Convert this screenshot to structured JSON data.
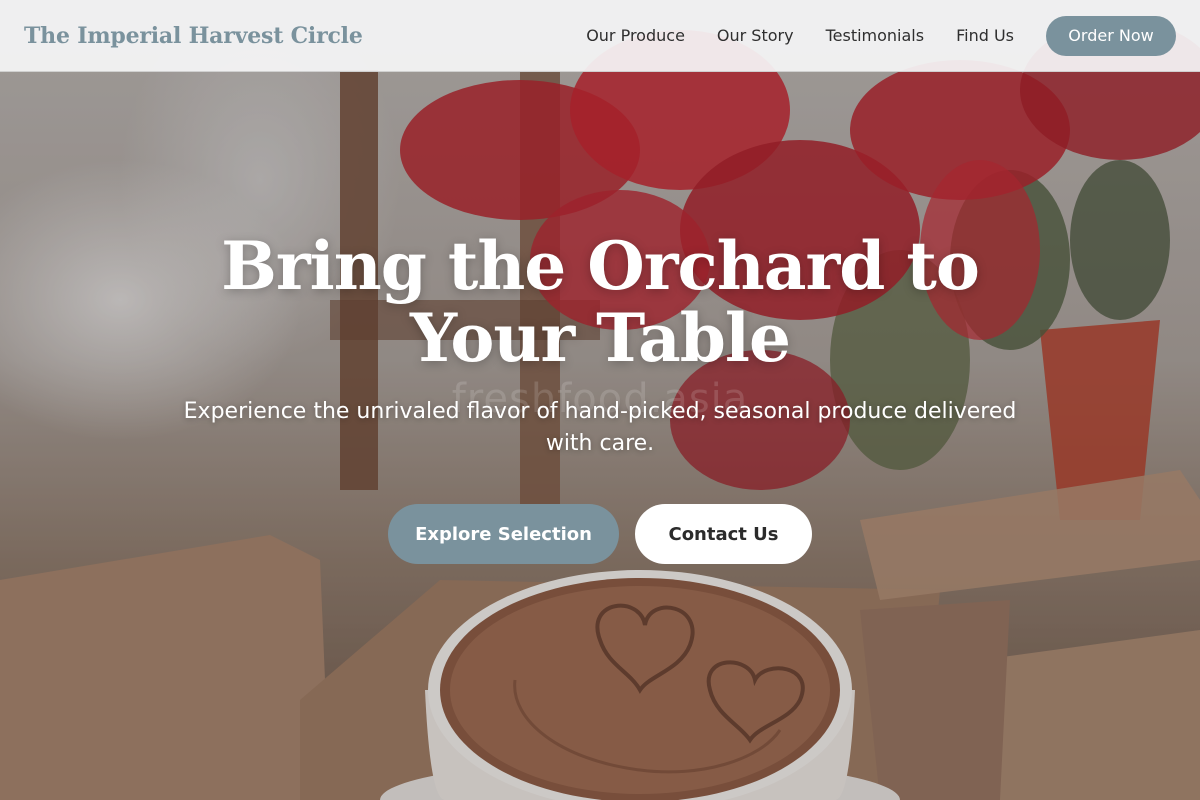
{
  "brand": {
    "name": "The Imperial Harvest Circle"
  },
  "nav": {
    "links": [
      "Our Produce",
      "Our Story",
      "Testimonials",
      "Find Us"
    ],
    "order_label": "Order Now"
  },
  "hero": {
    "title": "Bring the Orchard to Your Table",
    "subtitle": "Experience the unrivaled flavor of hand-picked, seasonal produce delivered with care.",
    "watermark": "freshfood.asia",
    "primary_cta": "Explore Selection",
    "secondary_cta": "Contact Us"
  },
  "colors": {
    "accent": "#7a929d",
    "nav_bg": "#f5f5f6",
    "text_dark": "#2f2f2f",
    "white": "#ffffff"
  }
}
